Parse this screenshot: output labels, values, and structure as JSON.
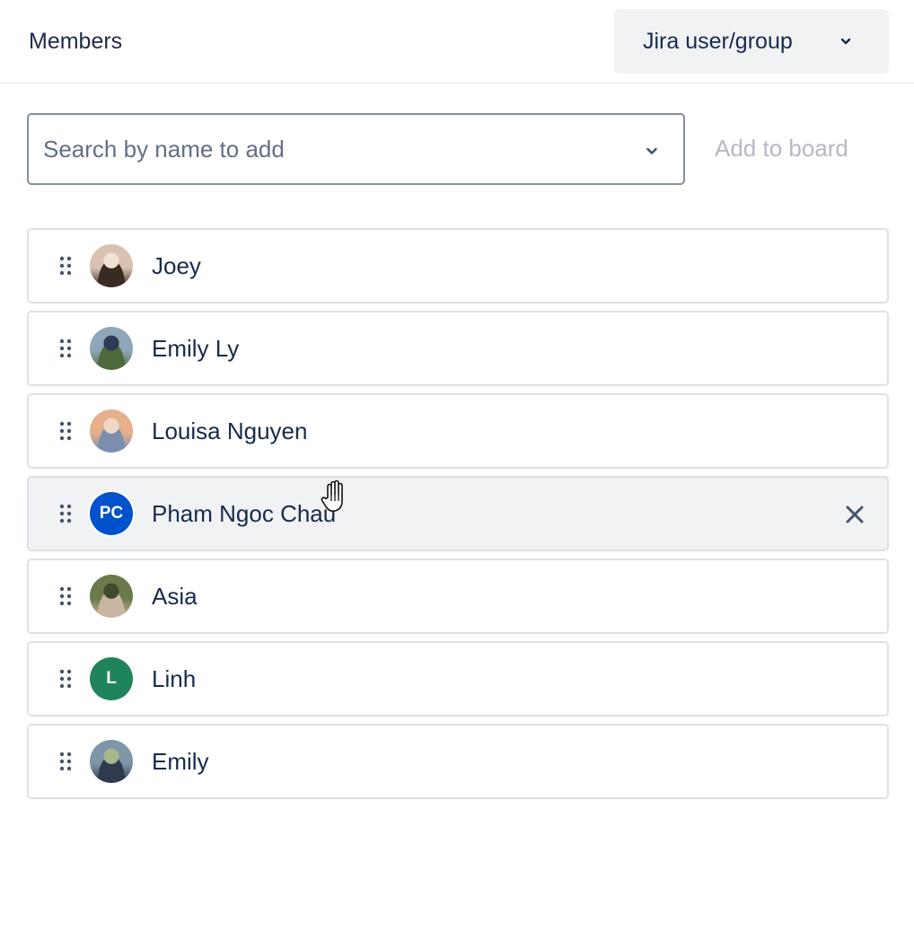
{
  "header": {
    "title": "Members",
    "type_select": {
      "value": "Jira user/group",
      "icon": "chevron-down-icon"
    }
  },
  "search": {
    "placeholder": "Search by name to add",
    "value": "",
    "icon": "chevron-down-icon",
    "add_button_label": "Add to board",
    "add_button_disabled": true
  },
  "members": [
    {
      "name": "Joey",
      "avatar_type": "photo",
      "photo_palette": [
        "#d9c2b2",
        "#3a2a24",
        "#f1e2d6"
      ]
    },
    {
      "name": "Emily Ly",
      "avatar_type": "photo",
      "photo_palette": [
        "#8fa6b8",
        "#4d6b3a",
        "#2f3a55"
      ]
    },
    {
      "name": "Louisa Nguyen",
      "avatar_type": "photo",
      "photo_palette": [
        "#e6b08a",
        "#7a8fb0",
        "#f2d7c8"
      ]
    },
    {
      "name": "Pham Ngoc Chau",
      "avatar_type": "initials",
      "initials": "PC",
      "color": "#0052cc",
      "hovered": true,
      "remove_icon": "close-icon"
    },
    {
      "name": "Asia",
      "avatar_type": "photo",
      "photo_palette": [
        "#6b7a4a",
        "#c9b7a3",
        "#3e4a2c"
      ]
    },
    {
      "name": "Linh",
      "avatar_type": "initials",
      "initials": "L",
      "color": "#1f845a"
    },
    {
      "name": "Emily",
      "avatar_type": "photo",
      "photo_palette": [
        "#7f96a8",
        "#2f3a4f",
        "#a9b88a"
      ]
    }
  ],
  "colors": {
    "text": "#172b4d",
    "border": "#dfe1e6",
    "hover_bg": "#f1f2f4",
    "disabled_text": "#b3b9c4"
  },
  "cursor": "grab-hand-cursor"
}
